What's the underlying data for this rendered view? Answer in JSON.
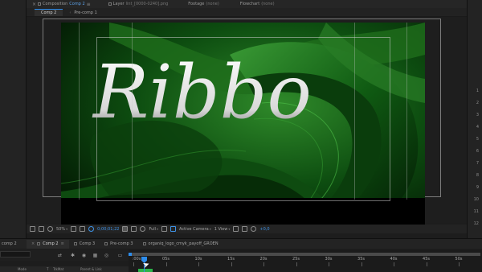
{
  "panel_header": {
    "composition_label": "Composition",
    "composition_value": "Comp 2",
    "layer_label": "Layer",
    "layer_value": "lint_[0000-0240].png",
    "footage_label": "Footage",
    "footage_value": "(none)",
    "flowchart_label": "Flowchart",
    "flowchart_value": "(none)"
  },
  "comp_tabs": [
    {
      "label": "Comp 2",
      "active": true
    },
    {
      "label": "Pre-comp 1",
      "active": false
    }
  ],
  "viewer": {
    "title_text": "Ribbo",
    "magnification": "50%",
    "timecode": "0;00;01;22",
    "resolution": "Full",
    "camera": "Active Camera",
    "views": "1 View",
    "exposure": "+0,0"
  },
  "right_strip_numbers": [
    "1",
    "2",
    "3",
    "4",
    "5",
    "6",
    "7",
    "8",
    "9",
    "10",
    "11",
    "12"
  ],
  "timeline": {
    "left_tab_label": "comp 2",
    "tabs": [
      {
        "label": "Comp 2",
        "active": true
      },
      {
        "label": "Comp 3",
        "active": false
      },
      {
        "label": "Pre-comp 3",
        "active": false
      },
      {
        "label": "organiq_logo_cmyk_payoff_GROEN",
        "active": false
      }
    ],
    "columns": {
      "mode": "Mode",
      "t": "T",
      "trkmat": "TrkMat",
      "parent": "Parent & Link"
    },
    "ruler_labels": [
      ":00s",
      "05s",
      "10s",
      "15s",
      "20s",
      "25s",
      "30s",
      "35s",
      "40s",
      "45s",
      "50s"
    ]
  },
  "colors": {
    "accent": "#2d8ceb",
    "comp_green": "#0d5a14",
    "play_range": "#2bb34a"
  }
}
